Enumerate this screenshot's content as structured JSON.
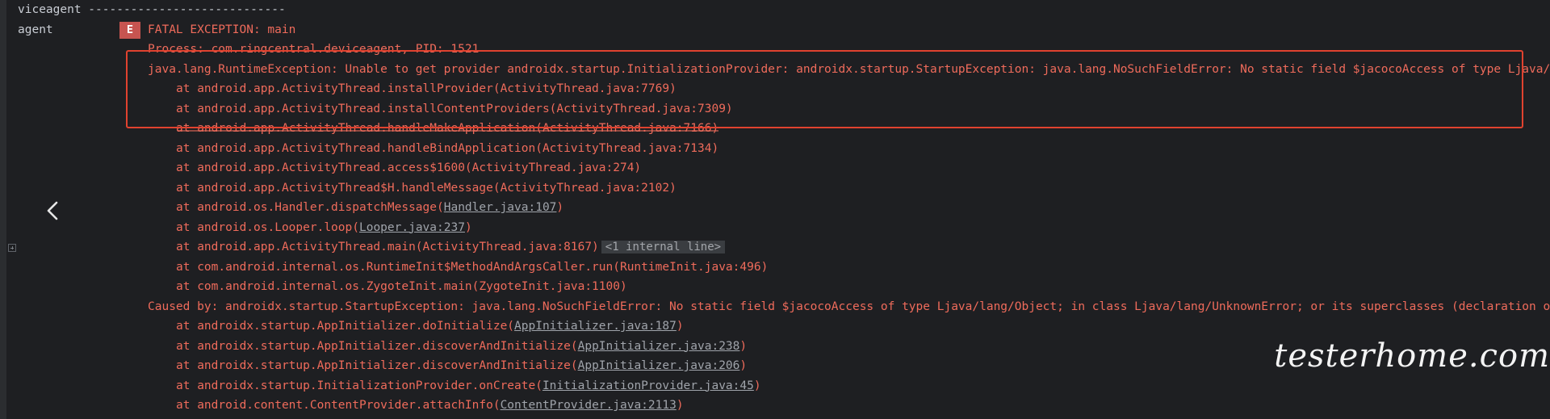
{
  "tags": {
    "line0": "viceagent ----------------------------",
    "line1": "agent"
  },
  "level_badge": "E",
  "header_line": "FATAL EXCEPTION: main",
  "process_line": "Process: com.ringcentral.deviceagent, PID: 1521",
  "exception_line": "java.lang.RuntimeException: Unable to get provider androidx.startup.InitializationProvider: androidx.startup.StartupException: java.lang.NoSuchFieldError: No static field $jacocoAccess of type Ljava/",
  "frames1": [
    {
      "prefix": "at android.app.ActivityThread.installProvider(ActivityThread.java:7769)"
    },
    {
      "prefix": "at android.app.ActivityThread.installContentProviders(ActivityThread.java:7309)"
    },
    {
      "prefix": "at android.app.ActivityThread.handleMakeApplication(ActivityThread.java:7166)"
    },
    {
      "prefix": "at android.app.ActivityThread.handleBindApplication(ActivityThread.java:7134)"
    },
    {
      "prefix": "at android.app.ActivityThread.access$1600(ActivityThread.java:274)"
    },
    {
      "prefix": "at android.app.ActivityThread$H.handleMessage(ActivityThread.java:2102)"
    },
    {
      "prefix": "at android.os.Handler.dispatchMessage(",
      "link": "Handler.java:107",
      "suffix": ")"
    },
    {
      "prefix": "at android.os.Looper.loop(",
      "link": "Looper.java:237",
      "suffix": ")"
    },
    {
      "prefix": "at android.app.ActivityThread.main(ActivityThread.java:8167)",
      "fold": "<1 internal line>"
    },
    {
      "prefix": "at com.android.internal.os.RuntimeInit$MethodAndArgsCaller.run(RuntimeInit.java:496)"
    },
    {
      "prefix": "at com.android.internal.os.ZygoteInit.main(ZygoteInit.java:1100)"
    }
  ],
  "caused_by_line": "Caused by: androidx.startup.StartupException: java.lang.NoSuchFieldError: No static field $jacocoAccess of type Ljava/lang/Object; in class Ljava/lang/UnknownError; or its superclasses (declaration of",
  "frames2": [
    {
      "prefix": "at androidx.startup.AppInitializer.doInitialize(",
      "link": "AppInitializer.java:187",
      "suffix": ")"
    },
    {
      "prefix": "at androidx.startup.AppInitializer.discoverAndInitialize(",
      "link": "AppInitializer.java:238",
      "suffix": ")"
    },
    {
      "prefix": "at androidx.startup.AppInitializer.discoverAndInitialize(",
      "link": "AppInitializer.java:206",
      "suffix": ")"
    },
    {
      "prefix": "at androidx.startup.InitializationProvider.onCreate(",
      "link": "InitializationProvider.java:45",
      "suffix": ")"
    },
    {
      "prefix": "at android.content.ContentProvider.attachInfo(",
      "link": "ContentProvider.java:2113",
      "suffix": ")"
    }
  ],
  "watermark": "testerhome.com",
  "colors": {
    "background": "#1e1f22",
    "error_text": "#ef6b5b",
    "badge": "#c75450",
    "highlight_box": "#e0422f"
  }
}
